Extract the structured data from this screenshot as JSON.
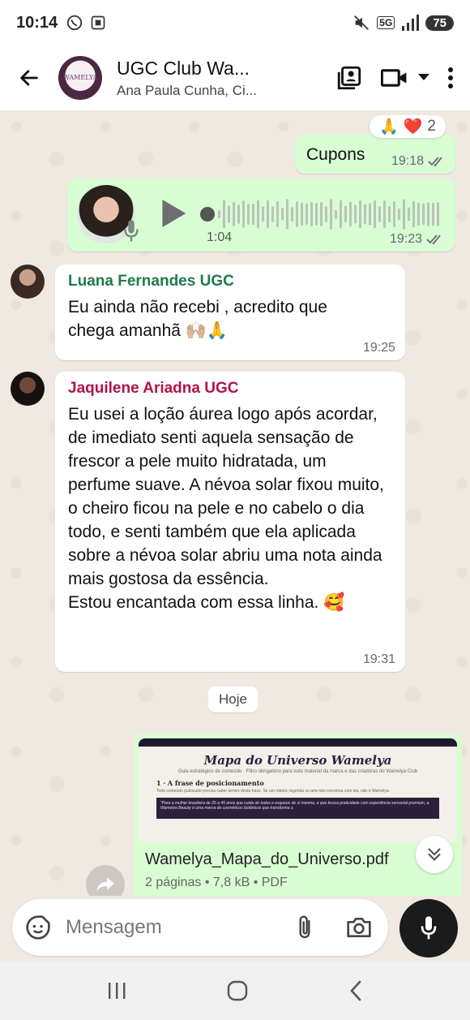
{
  "status_bar": {
    "time": "10:14",
    "network": "5G",
    "battery": "75",
    "icons_left": [
      "whatsapp-icon",
      "screenshot-icon"
    ],
    "icons_right": [
      "mute-icon",
      "signal-icon",
      "battery-icon"
    ]
  },
  "header": {
    "group_name": "UGC Club Wa...",
    "group_subtitle": "Ana Paula Cunha, Ci...",
    "avatar_text": "WAMELYA",
    "actions": [
      "contacts-card-icon",
      "video-call-icon",
      "dropdown-icon",
      "more-options-icon"
    ]
  },
  "messages": [
    {
      "type": "outgoing-text",
      "text": "Cupons",
      "time": "19:18",
      "reactions": [
        "🙏",
        "❤️"
      ],
      "reaction_count": "2"
    },
    {
      "type": "outgoing-voice",
      "duration": "1:04",
      "time": "19:23"
    },
    {
      "type": "incoming-text",
      "sender": "Luana Fernandes UGC",
      "sender_color": "#1f7a4d",
      "text_line1": "Eu ainda não recebi , acredito que",
      "text_line2": "chega amanhã 🙌🏼🙏",
      "time": "19:25"
    },
    {
      "type": "incoming-text",
      "sender": "Jaquilene Ariadna UGC",
      "sender_color": "#b0144b",
      "text": "Eu usei a loção áurea logo após acordar, de imediato senti aquela sensação de frescor a pele muito hidratada, um perfume suave. A névoa solar fixou muito, o cheiro ficou na pele e no cabelo o dia todo, e senti também que ela aplicada sobre a névoa solar abriu uma nota ainda mais gostosa da essência.",
      "text_last": "Estou encantada com essa linha. 🥰",
      "time": "19:31"
    }
  ],
  "date_divider": "Hoje",
  "document": {
    "preview_title": "Mapa do Universo Wamelya",
    "preview_subtitle": "Guia estratégico de conteúdo · Filtro obrigatório para todo material da marca e das criadoras do Wamelya Club",
    "preview_heading": "1 · A frase de posicionamento",
    "preview_body": "Todo conteúdo publicado precisa caber dentro desta frase. Se um roteiro, legenda ou arte não conversa com ela, não é Wamelya.",
    "preview_quote": "\"Para a mulher brasileira de 25 a 45 anos que cuida de todos e esquece de si mesma, e que busca praticidade com experiência sensorial premium, a Wamelya Beauty é uma marca de cosméticos botânicos que transforma o",
    "file_name": "Wamelya_Mapa_do_Universo.pdf",
    "file_meta": "2 páginas • 7,8 kB • PDF"
  },
  "input": {
    "placeholder": "Mensagem"
  },
  "colors": {
    "outgoing_bubble": "#d8fdd2",
    "incoming_bubble": "#ffffff",
    "chat_background": "#efe9e1",
    "read_ticks": "#53bdeb"
  }
}
